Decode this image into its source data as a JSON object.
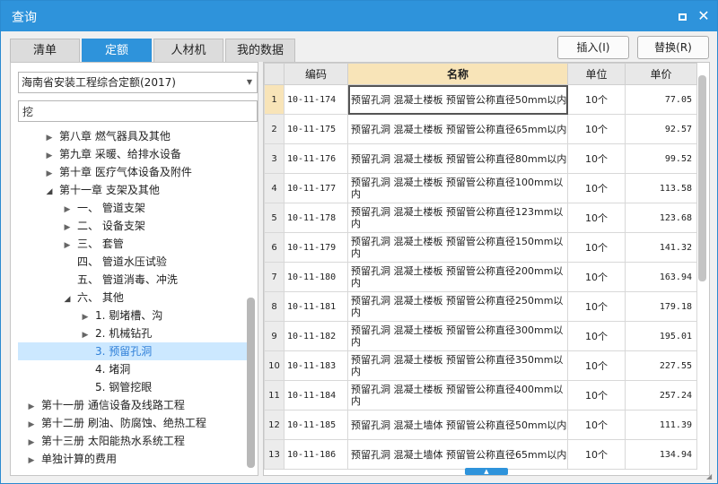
{
  "window": {
    "title": "查询",
    "maximize_icon": "maximize-icon",
    "close_icon": "close-icon"
  },
  "tabs": [
    {
      "label": "清单",
      "active": false
    },
    {
      "label": "定额",
      "active": true
    },
    {
      "label": "人材机",
      "active": false
    },
    {
      "label": "我的数据",
      "active": false
    }
  ],
  "actions": {
    "insert_label": "插入(I)",
    "replace_label": "替换(R)"
  },
  "left": {
    "quota_book": "海南省安装工程综合定额(2017)",
    "search_value": "挖",
    "tree": [
      {
        "label": "第八章 燃气器具及其他",
        "level": 1,
        "arrow": "collapsed",
        "selected": false
      },
      {
        "label": "第九章 采暖、给排水设备",
        "level": 1,
        "arrow": "collapsed",
        "selected": false
      },
      {
        "label": "第十章 医疗气体设备及附件",
        "level": 1,
        "arrow": "collapsed",
        "selected": false
      },
      {
        "label": "第十一章 支架及其他",
        "level": 1,
        "arrow": "expanded",
        "selected": false
      },
      {
        "label": "一、 管道支架",
        "level": 2,
        "arrow": "collapsed",
        "selected": false
      },
      {
        "label": "二、 设备支架",
        "level": 2,
        "arrow": "collapsed",
        "selected": false
      },
      {
        "label": "三、 套管",
        "level": 2,
        "arrow": "collapsed",
        "selected": false
      },
      {
        "label": "四、 管道水压试验",
        "level": 2,
        "arrow": "none",
        "selected": false
      },
      {
        "label": "五、 管道消毒、冲洗",
        "level": 2,
        "arrow": "none",
        "selected": false
      },
      {
        "label": "六、 其他",
        "level": 2,
        "arrow": "expanded",
        "selected": false
      },
      {
        "label": "1. 剔堵槽、沟",
        "level": 3,
        "arrow": "collapsed",
        "selected": false
      },
      {
        "label": "2. 机械钻孔",
        "level": 3,
        "arrow": "collapsed",
        "selected": false
      },
      {
        "label": "3. 预留孔洞",
        "level": 3,
        "arrow": "none",
        "selected": true
      },
      {
        "label": "4. 堵洞",
        "level": 3,
        "arrow": "none",
        "selected": false
      },
      {
        "label": "5. 钢管挖眼",
        "level": 3,
        "arrow": "none",
        "selected": false
      },
      {
        "label": "第十一册 通信设备及线路工程",
        "level": 0,
        "arrow": "collapsed",
        "selected": false
      },
      {
        "label": "第十二册 刷油、防腐蚀、绝热工程",
        "level": 0,
        "arrow": "collapsed",
        "selected": false
      },
      {
        "label": "第十三册 太阳能热水系统工程",
        "level": 0,
        "arrow": "collapsed",
        "selected": false
      },
      {
        "label": "单独计算的费用",
        "level": 0,
        "arrow": "collapsed",
        "selected": false
      }
    ]
  },
  "grid": {
    "headers": {
      "code": "编码",
      "name": "名称",
      "unit": "单位",
      "price": "单价"
    },
    "rows": [
      {
        "no": "1",
        "code": "10-11-174",
        "name": "预留孔洞 混凝土楼板 预留管公称直径50mm以内",
        "unit": "10个",
        "price": "77.05"
      },
      {
        "no": "2",
        "code": "10-11-175",
        "name": "预留孔洞 混凝土楼板 预留管公称直径65mm以内",
        "unit": "10个",
        "price": "92.57"
      },
      {
        "no": "3",
        "code": "10-11-176",
        "name": "预留孔洞 混凝土楼板 预留管公称直径80mm以内",
        "unit": "10个",
        "price": "99.52"
      },
      {
        "no": "4",
        "code": "10-11-177",
        "name": "预留孔洞 混凝土楼板 预留管公称直径100mm以内",
        "unit": "10个",
        "price": "113.58"
      },
      {
        "no": "5",
        "code": "10-11-178",
        "name": "预留孔洞 混凝土楼板 预留管公称直径123mm以内",
        "unit": "10个",
        "price": "123.68"
      },
      {
        "no": "6",
        "code": "10-11-179",
        "name": "预留孔洞 混凝土楼板 预留管公称直径150mm以内",
        "unit": "10个",
        "price": "141.32"
      },
      {
        "no": "7",
        "code": "10-11-180",
        "name": "预留孔洞 混凝土楼板 预留管公称直径200mm以内",
        "unit": "10个",
        "price": "163.94"
      },
      {
        "no": "8",
        "code": "10-11-181",
        "name": "预留孔洞 混凝土楼板 预留管公称直径250mm以内",
        "unit": "10个",
        "price": "179.18"
      },
      {
        "no": "9",
        "code": "10-11-182",
        "name": "预留孔洞 混凝土楼板 预留管公称直径300mm以内",
        "unit": "10个",
        "price": "195.01"
      },
      {
        "no": "10",
        "code": "10-11-183",
        "name": "预留孔洞 混凝土楼板 预留管公称直径350mm以内",
        "unit": "10个",
        "price": "227.55"
      },
      {
        "no": "11",
        "code": "10-11-184",
        "name": "预留孔洞 混凝土楼板 预留管公称直径400mm以内",
        "unit": "10个",
        "price": "257.24"
      },
      {
        "no": "12",
        "code": "10-11-185",
        "name": "预留孔洞 混凝土墙体 预留管公称直径50mm以内",
        "unit": "10个",
        "price": "111.39"
      },
      {
        "no": "13",
        "code": "10-11-186",
        "name": "预留孔洞 混凝土墙体 预留管公称直径65mm以内",
        "unit": "10个",
        "price": "134.94"
      }
    ]
  },
  "colors": {
    "accent": "#2e93db",
    "selected_row": "#cce8ff",
    "name_header": "#f8e4b8"
  }
}
